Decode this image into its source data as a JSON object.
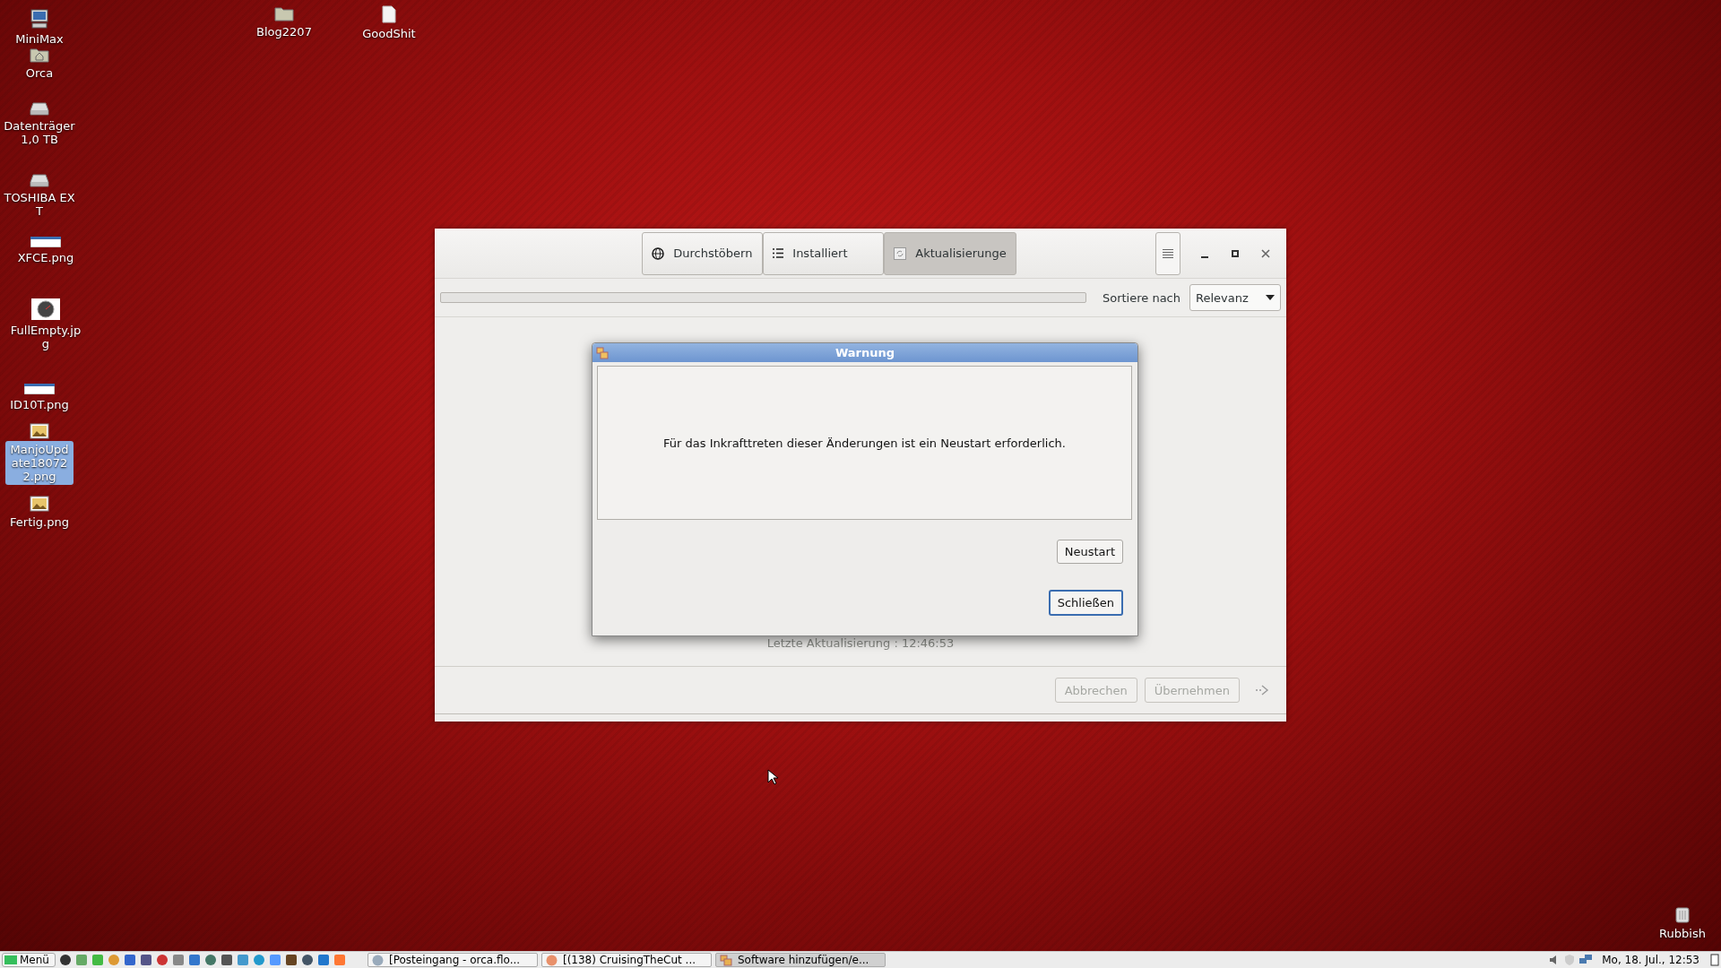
{
  "desktop_icons": [
    {
      "label": "MiniMax",
      "kind": "computer",
      "selected": false
    },
    {
      "label": "Orca",
      "kind": "home",
      "selected": false
    },
    {
      "label": "Datenträger 1,0 TB",
      "kind": "drive",
      "selected": false
    },
    {
      "label": "TOSHIBA EXT",
      "kind": "drive",
      "selected": false
    },
    {
      "label": "XFCE.png",
      "kind": "screenshot",
      "selected": false
    },
    {
      "label": "FullEmpty.jpg",
      "kind": "gauge",
      "selected": false
    },
    {
      "label": "ID10T.png",
      "kind": "screenshot",
      "selected": false
    },
    {
      "label": "ManjoUpdate180722.png",
      "kind": "image",
      "selected": true
    },
    {
      "label": "Fertig.png",
      "kind": "image",
      "selected": false
    },
    {
      "label": "Blog2207",
      "kind": "folder",
      "selected": false
    },
    {
      "label": "GoodShit",
      "kind": "document",
      "selected": false
    },
    {
      "label": "Rubbish",
      "kind": "trash",
      "selected": false
    }
  ],
  "window": {
    "tabs": [
      {
        "label": "Durchstöbern",
        "kind": "globe",
        "selected": false
      },
      {
        "label": "Installiert",
        "kind": "list",
        "selected": false
      },
      {
        "label": "Aktualisierunge",
        "kind": "refresh",
        "selected": true
      }
    ],
    "sort_label": "Sortiere nach",
    "sort_value": "Relevanz",
    "last_update": "Letzte Aktualisierung : 12:46:53",
    "footer_buttons": [
      {
        "label": "Abbrechen",
        "disabled": true
      },
      {
        "label": "Übernehmen",
        "disabled": true
      }
    ]
  },
  "dialog": {
    "title": "Warnung",
    "message": "Für das Inkrafttreten dieser Änderungen ist ein Neustart erforderlich.",
    "buttons": [
      {
        "label": "Neustart",
        "focused": false
      },
      {
        "label": "Schließen",
        "focused": true
      }
    ]
  },
  "taskbar": {
    "menu": "Menü",
    "tasks": [
      {
        "label": "[Posteingang - orca.flo...",
        "kind": "mail",
        "selected": false
      },
      {
        "label": "[(138) CruisingTheCut ...",
        "kind": "browser",
        "selected": false
      },
      {
        "label": "Software hinzufügen/e...",
        "kind": "software",
        "selected": true
      }
    ],
    "clock": "Mo, 18. Jul., 12:53"
  }
}
